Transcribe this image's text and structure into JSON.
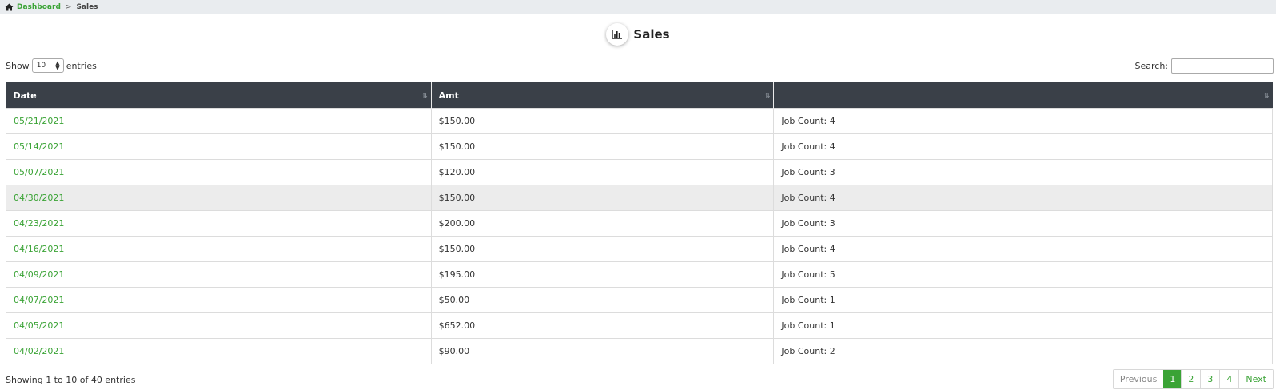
{
  "breadcrumb": {
    "home_label": "Dashboard",
    "separator": ">",
    "current": "Sales"
  },
  "page": {
    "title": "Sales",
    "icon": "bar-chart-icon"
  },
  "length": {
    "show_label": "Show",
    "value": "10",
    "entries_label": "entries"
  },
  "search": {
    "label": "Search:",
    "value": "",
    "placeholder": ""
  },
  "table": {
    "columns": [
      "Date",
      "Amt",
      ""
    ],
    "rows": [
      {
        "date": "05/21/2021",
        "amt": "$150.00",
        "jobs": "Job Count: 4"
      },
      {
        "date": "05/14/2021",
        "amt": "$150.00",
        "jobs": "Job Count: 4"
      },
      {
        "date": "05/07/2021",
        "amt": "$120.00",
        "jobs": "Job Count: 3"
      },
      {
        "date": "04/30/2021",
        "amt": "$150.00",
        "jobs": "Job Count: 4"
      },
      {
        "date": "04/23/2021",
        "amt": "$200.00",
        "jobs": "Job Count: 3"
      },
      {
        "date": "04/16/2021",
        "amt": "$150.00",
        "jobs": "Job Count: 4"
      },
      {
        "date": "04/09/2021",
        "amt": "$195.00",
        "jobs": "Job Count: 5"
      },
      {
        "date": "04/07/2021",
        "amt": "$50.00",
        "jobs": "Job Count: 1"
      },
      {
        "date": "04/05/2021",
        "amt": "$652.00",
        "jobs": "Job Count: 1"
      },
      {
        "date": "04/02/2021",
        "amt": "$90.00",
        "jobs": "Job Count: 2"
      }
    ]
  },
  "info": "Showing 1 to 10 of 40 entries",
  "pagination": {
    "previous": "Previous",
    "pages": [
      "1",
      "2",
      "3",
      "4"
    ],
    "next": "Next",
    "active": "1"
  },
  "colors": {
    "accent": "#3aa335",
    "header_bg": "#3a4048",
    "breadcrumb_bg": "#e9ecef",
    "hover_row": "#ececec"
  }
}
